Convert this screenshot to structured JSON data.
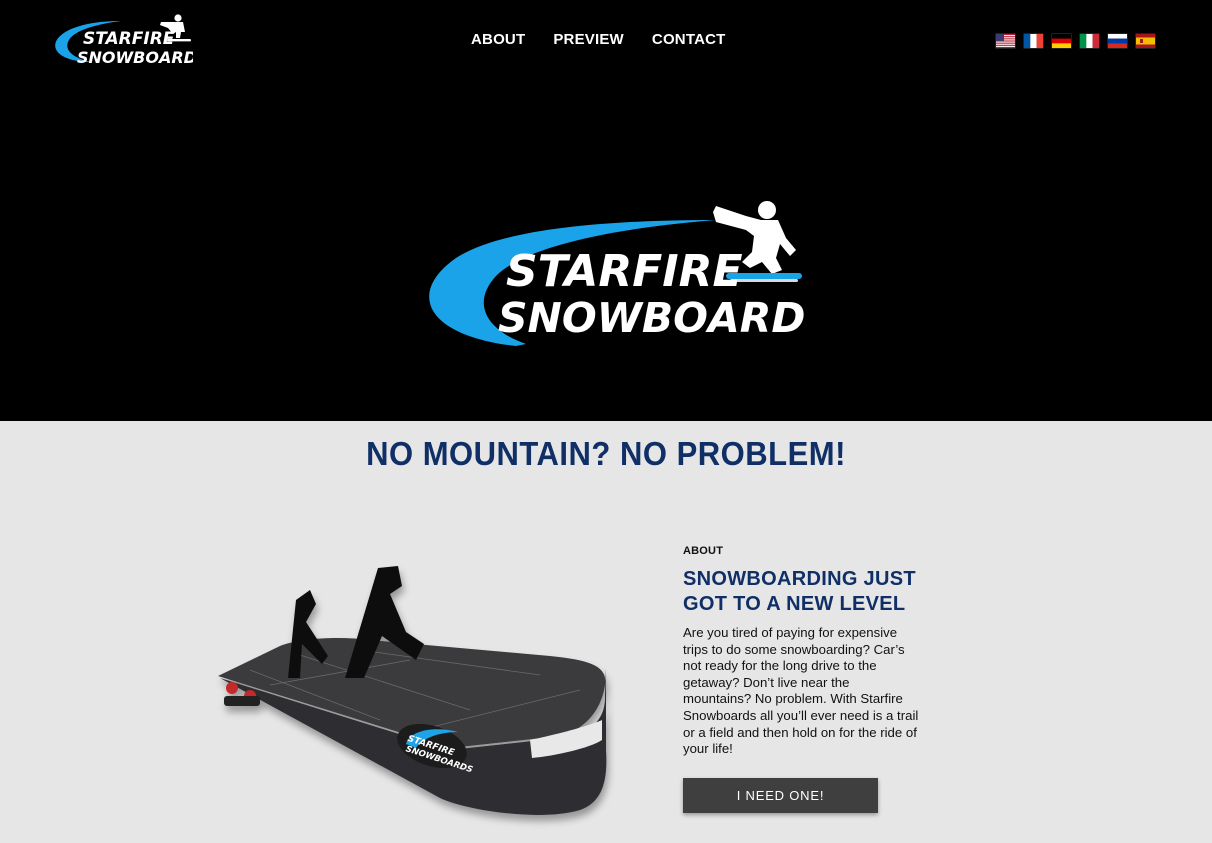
{
  "header": {
    "logo_line1": "STARFIRE",
    "logo_line2": "SNOWBOARDS",
    "nav": [
      {
        "label": "ABOUT"
      },
      {
        "label": "PREVIEW"
      },
      {
        "label": "CONTACT"
      }
    ],
    "languages": [
      {
        "code": "en-us",
        "flag": "us-flag-icon"
      },
      {
        "code": "fr",
        "flag": "france-flag-icon"
      },
      {
        "code": "de",
        "flag": "germany-flag-icon"
      },
      {
        "code": "it",
        "flag": "italy-flag-icon"
      },
      {
        "code": "ru",
        "flag": "russia-flag-icon"
      },
      {
        "code": "es",
        "flag": "spain-flag-icon"
      }
    ]
  },
  "hero": {
    "logo_line1": "STARFIRE",
    "logo_line2": "SNOWBOARDS"
  },
  "main": {
    "tagline": "NO MOUNTAIN? NO PROBLEM!",
    "about": {
      "eyebrow": "ABOUT",
      "heading_line1": "SNOWBOARDING JUST",
      "heading_line2": "GOT TO A NEW LEVEL",
      "body": "Are you tired of paying for expensive trips to do some snowboarding? Car’s not ready for the long drive to the getaway? Don’t live near the mountains? No problem. With Starfire Snowboards all you’ll ever need is a trail or a field and then hold on for the ride of your life!",
      "cta_label": "I NEED ONE!"
    },
    "product_logo_line1": "STARFIRE",
    "product_logo_line2": "SNOWBOARDS"
  },
  "colors": {
    "hero_bg": "#000000",
    "page_bg": "#e6e6e6",
    "brand_blue": "#1aa3e8",
    "heading_navy": "#0f2f66",
    "button_bg": "#3f3f3f"
  }
}
